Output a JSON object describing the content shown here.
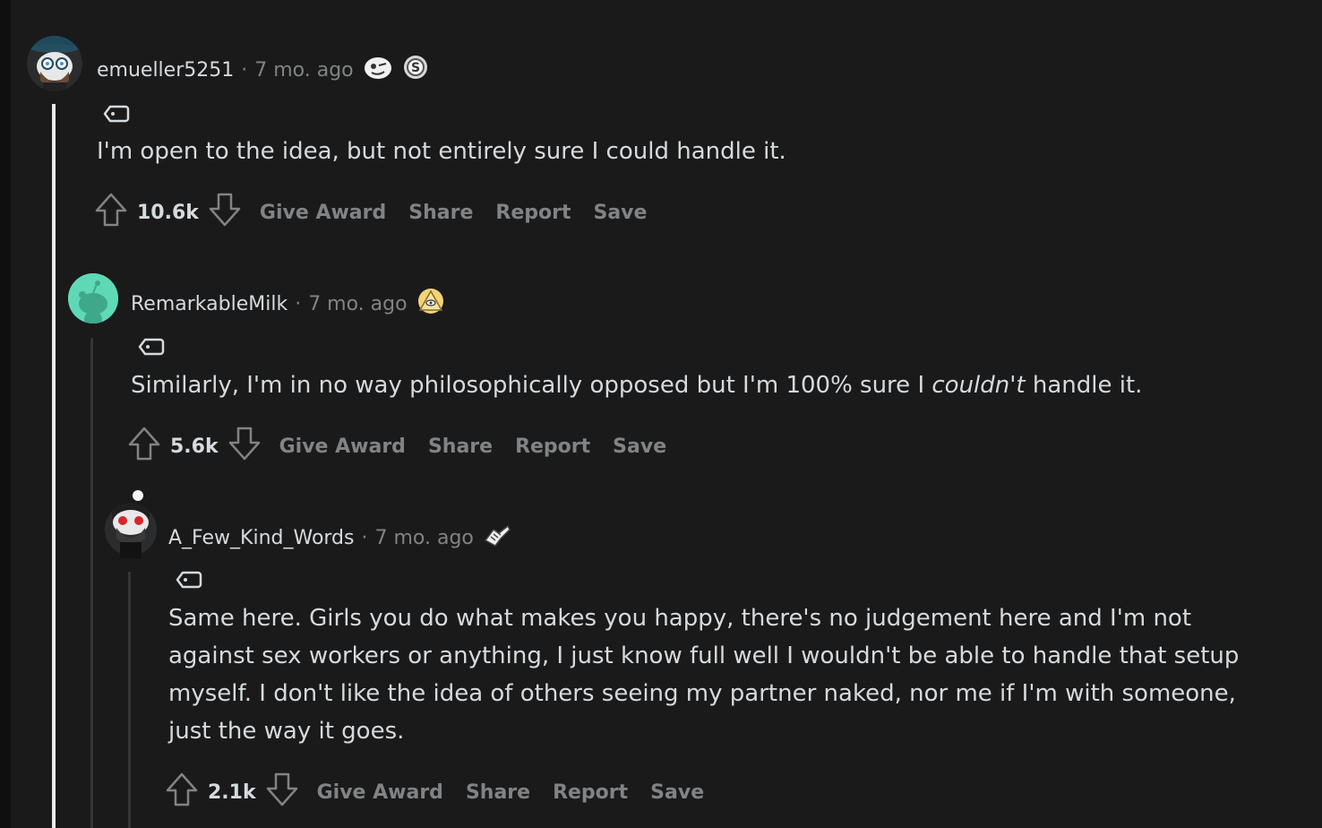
{
  "comments": [
    {
      "user": "emueller5251",
      "separator": "·",
      "time": "7 mo. ago",
      "body": "I'm open to the idea, but not entirely sure I could handle it.",
      "score": "10.6k"
    },
    {
      "user": "RemarkableMilk",
      "separator": "·",
      "time": "7 mo. ago",
      "body_pre": "Similarly, I'm in no way philosophically opposed but I'm 100% sure I ",
      "body_em": "couldn't",
      "body_post": " handle it.",
      "score": "5.6k"
    },
    {
      "user": "A_Few_Kind_Words",
      "separator": "·",
      "time": "7 mo. ago",
      "body_lines": [
        "Same here. Girls you do what makes you happy, there's no judgement here and I'm not",
        "against sex workers or anything, I just know full well I wouldn't be able to handle that setup",
        "myself. I don't like the idea of others seeing my partner naked, nor me if I'm with someone,",
        "just the way it goes."
      ],
      "score": "2.1k"
    }
  ],
  "actions": {
    "give_award": "Give Award",
    "share": "Share",
    "report": "Report",
    "save": "Save"
  },
  "colors": {
    "background": "#1a1a1b",
    "text": "#d7dadc",
    "muted": "#818384",
    "avatar_teal": "#5fd9b5"
  }
}
